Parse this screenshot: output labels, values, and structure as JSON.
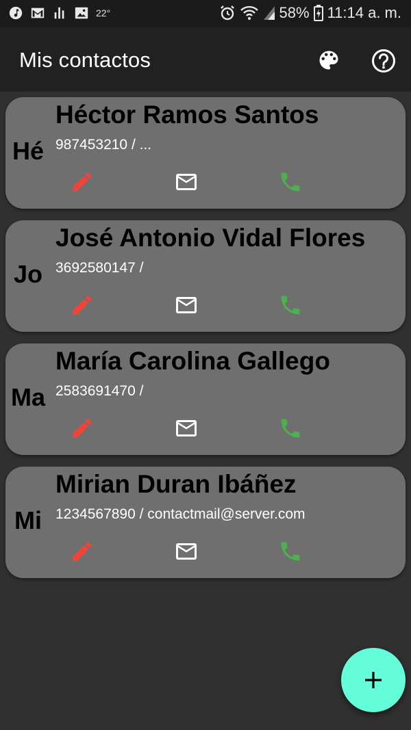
{
  "status_bar": {
    "temperature": "22°",
    "battery": "58%",
    "time": "11:14 a. m."
  },
  "app_bar": {
    "title": "Mis contactos",
    "icons": [
      "palette-icon",
      "help-icon"
    ]
  },
  "contacts": [
    {
      "initials": "Hé",
      "name": "Héctor Ramos Santos",
      "detail": "987453210 / ..."
    },
    {
      "initials": "Jo",
      "name": "José Antonio Vidal Flores",
      "detail": "3692580147 /"
    },
    {
      "initials": "Ma",
      "name": "María Carolina Gallego",
      "detail": "2583691470 /"
    },
    {
      "initials": "Mi",
      "name": "Mirian Duran Ibáñez",
      "detail": "1234567890 / contactmail@server.com"
    }
  ],
  "fab": {
    "icon": "plus-icon"
  },
  "colors": {
    "background": "#303030",
    "app_bar": "#212121",
    "card": "#6f6f6f",
    "edit": "#f44336",
    "call": "#4caf50",
    "fab": "#64ffda"
  }
}
